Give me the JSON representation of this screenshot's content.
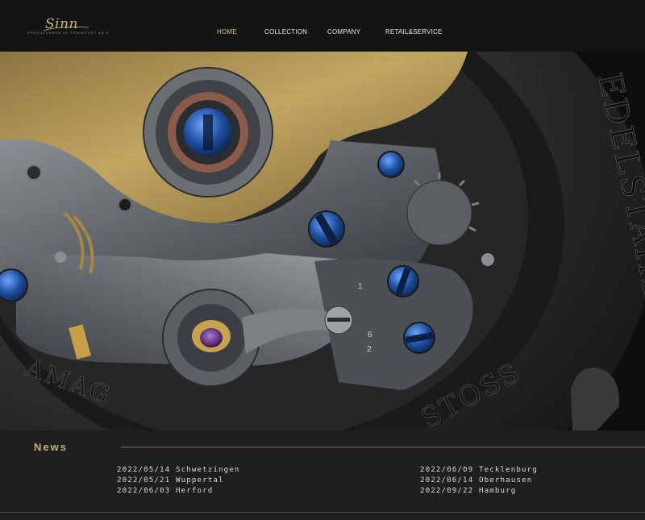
{
  "header": {
    "logo": {
      "wordmark": "Sinn",
      "tagline": "Spezialuhren zu Frankfurt am Main"
    },
    "nav": [
      {
        "label": "HOME",
        "active": true
      },
      {
        "label": "COLLECTION",
        "active": false
      },
      {
        "label": "COMPANY",
        "active": false
      },
      {
        "label": "RETAIL&SERVICE",
        "active": false
      }
    ]
  },
  "hero": {
    "case_engraving_right": "EDELSTAHL",
    "case_engraving_bottom_right": "STOSS",
    "case_engraving_bottom_left": "AMAG",
    "balance_marks": [
      "1",
      "6",
      "2"
    ]
  },
  "news": {
    "title": "News",
    "left": [
      "2022/05/14 Schwetzingen",
      "2022/05/21 Wuppertal",
      "2022/06/03 Herford"
    ],
    "right": [
      "2022/06/09 Tecklenburg",
      "2022/06/14 Oberhausen",
      "2022/09/22 Hamburg"
    ]
  },
  "colors": {
    "accent_gold": "#c6b07a",
    "header_bg": "#141414",
    "news_bg": "#1f1f1f",
    "screw_blue": "#1f4f9e",
    "gold_rotor": "#b99a55"
  }
}
